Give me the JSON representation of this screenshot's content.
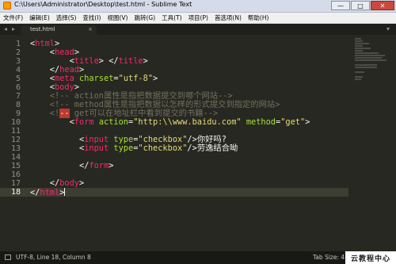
{
  "window": {
    "title": "C:\\Users\\Administrator\\Desktop\\test.html - Sublime Text",
    "minimize_label": "—",
    "maximize_label": "□",
    "close_label": "✕"
  },
  "menu": [
    {
      "label": "文件(F)"
    },
    {
      "label": "编辑(E)"
    },
    {
      "label": "选择(S)"
    },
    {
      "label": "查找(I)"
    },
    {
      "label": "视图(V)"
    },
    {
      "label": "跳转(G)"
    },
    {
      "label": "工具(T)"
    },
    {
      "label": "项目(P)"
    },
    {
      "label": "首选项(N)"
    },
    {
      "label": "帮助(H)"
    }
  ],
  "tabbar": {
    "left_arrow": "◂",
    "right_arrow": "▸",
    "dropdown": "▾",
    "tab": {
      "label": "test.html",
      "close": "×"
    }
  },
  "editor": {
    "current_line": 18,
    "lines": [
      {
        "n": "1",
        "segments": [
          {
            "t": "<",
            "c": "#f8f8f2"
          },
          {
            "t": "html",
            "c": "#f92672"
          },
          {
            "t": ">",
            "c": "#f8f8f2"
          }
        ]
      },
      {
        "n": "2",
        "segments": [
          {
            "t": "    <",
            "c": "#f8f8f2"
          },
          {
            "t": "head",
            "c": "#f92672"
          },
          {
            "t": ">",
            "c": "#f8f8f2"
          }
        ]
      },
      {
        "n": "3",
        "segments": [
          {
            "t": "        <",
            "c": "#f8f8f2"
          },
          {
            "t": "title",
            "c": "#f92672"
          },
          {
            "t": "> </",
            "c": "#f8f8f2"
          },
          {
            "t": "title",
            "c": "#f92672"
          },
          {
            "t": ">",
            "c": "#f8f8f2"
          }
        ]
      },
      {
        "n": "4",
        "segments": [
          {
            "t": "    </",
            "c": "#f8f8f2"
          },
          {
            "t": "head",
            "c": "#f92672"
          },
          {
            "t": ">",
            "c": "#f8f8f2"
          }
        ]
      },
      {
        "n": "5",
        "segments": [
          {
            "t": "    <",
            "c": "#f8f8f2"
          },
          {
            "t": "meta",
            "c": "#f92672"
          },
          {
            "t": " ",
            "c": "#f8f8f2"
          },
          {
            "t": "charset",
            "c": "#a6e22e"
          },
          {
            "t": "=",
            "c": "#f8f8f2"
          },
          {
            "t": "\"utf-8\"",
            "c": "#e6db74"
          },
          {
            "t": ">",
            "c": "#f8f8f2"
          }
        ]
      },
      {
        "n": "6",
        "segments": [
          {
            "t": "    <",
            "c": "#f8f8f2"
          },
          {
            "t": "body",
            "c": "#f92672"
          },
          {
            "t": ">",
            "c": "#f8f8f2"
          }
        ]
      },
      {
        "n": "7",
        "segments": [
          {
            "t": "    <!-- action属性是指把数据提交到哪个网站-->",
            "c": "#75715e"
          }
        ]
      },
      {
        "n": "8",
        "segments": [
          {
            "t": "    <!-- method属性是指把数据以怎样的形式提交到指定的网站>",
            "c": "#75715e"
          }
        ]
      },
      {
        "n": "9",
        "segments": [
          {
            "t": "    <!",
            "c": "#75715e"
          },
          {
            "t": "--",
            "c": "#f8f8f2",
            "sel": true
          },
          {
            "t": " get可以在地址栏中看到提交的书籍-->",
            "c": "#75715e"
          }
        ]
      },
      {
        "n": "10",
        "segments": [
          {
            "t": "        <",
            "c": "#f8f8f2"
          },
          {
            "t": "form",
            "c": "#f92672"
          },
          {
            "t": " ",
            "c": "#f8f8f2"
          },
          {
            "t": "action",
            "c": "#a6e22e"
          },
          {
            "t": "=",
            "c": "#f8f8f2"
          },
          {
            "t": "\"http:\\\\www.baidu.com\"",
            "c": "#e6db74"
          },
          {
            "t": " ",
            "c": "#f8f8f2"
          },
          {
            "t": "method",
            "c": "#a6e22e"
          },
          {
            "t": "=",
            "c": "#f8f8f2"
          },
          {
            "t": "\"get\"",
            "c": "#e6db74"
          },
          {
            "t": ">",
            "c": "#f8f8f2"
          }
        ]
      },
      {
        "n": "11",
        "segments": []
      },
      {
        "n": "12",
        "segments": [
          {
            "t": "          <",
            "c": "#f8f8f2"
          },
          {
            "t": "input",
            "c": "#f92672"
          },
          {
            "t": " ",
            "c": "#f8f8f2"
          },
          {
            "t": "type",
            "c": "#a6e22e"
          },
          {
            "t": "=",
            "c": "#f8f8f2"
          },
          {
            "t": "\"checkbox\"",
            "c": "#e6db74"
          },
          {
            "t": "/>你好吗?",
            "c": "#f8f8f2"
          }
        ]
      },
      {
        "n": "13",
        "segments": [
          {
            "t": "          <",
            "c": "#f8f8f2"
          },
          {
            "t": "input",
            "c": "#f92672"
          },
          {
            "t": " ",
            "c": "#f8f8f2"
          },
          {
            "t": "type",
            "c": "#a6e22e"
          },
          {
            "t": "=",
            "c": "#f8f8f2"
          },
          {
            "t": "\"checkbox\"",
            "c": "#e6db74"
          },
          {
            "t": "/>劳逸结合呦",
            "c": "#f8f8f2"
          }
        ]
      },
      {
        "n": "14",
        "segments": []
      },
      {
        "n": "15",
        "segments": [
          {
            "t": "          </",
            "c": "#f8f8f2"
          },
          {
            "t": "form",
            "c": "#f92672"
          },
          {
            "t": ">",
            "c": "#f8f8f2"
          }
        ]
      },
      {
        "n": "16",
        "segments": []
      },
      {
        "n": "17",
        "segments": [
          {
            "t": "    </",
            "c": "#f8f8f2"
          },
          {
            "t": "body",
            "c": "#f92672"
          },
          {
            "t": ">",
            "c": "#f8f8f2"
          }
        ]
      },
      {
        "n": "18",
        "segments": [
          {
            "t": "</",
            "c": "#f8f8f2"
          },
          {
            "t": "html",
            "c": "#f92672"
          },
          {
            "t": ">",
            "c": "#f8f8f2"
          }
        ],
        "cursor": true
      }
    ]
  },
  "status": {
    "position": "UTF-8, Line 18, Column 8",
    "tab_size": "Tab Size: 4",
    "watermark": "云教程中心"
  },
  "colors": {
    "background": "#272822",
    "tag": "#f92672",
    "attribute": "#a6e22e",
    "string": "#e6db74",
    "comment": "#75715e"
  }
}
